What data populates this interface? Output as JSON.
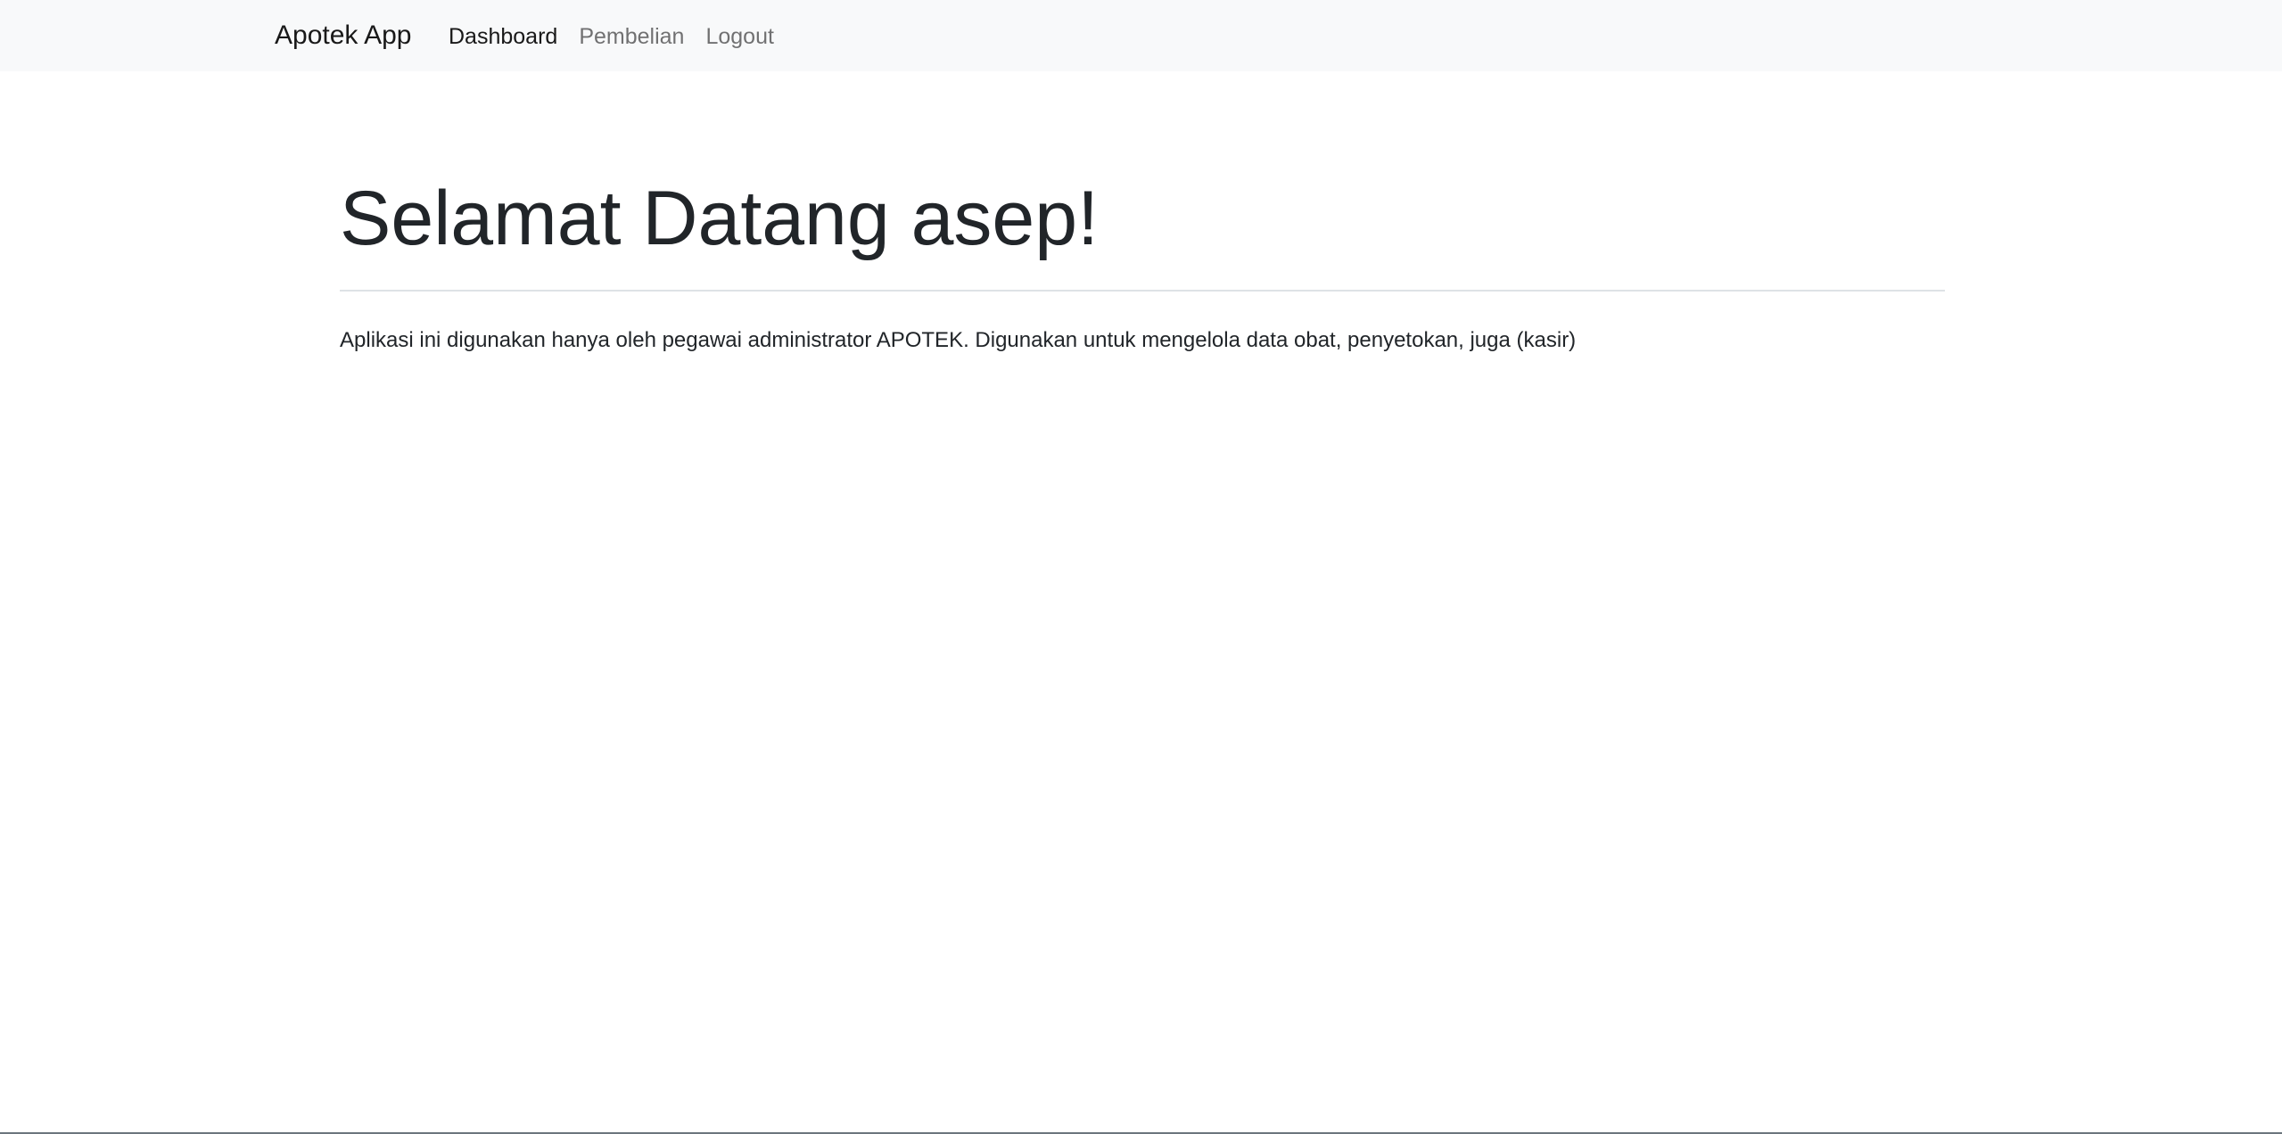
{
  "navbar": {
    "brand": "Apotek App",
    "items": [
      {
        "label": "Dashboard",
        "active": true
      },
      {
        "label": "Pembelian",
        "active": false
      },
      {
        "label": "Logout",
        "active": false
      }
    ]
  },
  "main": {
    "heading": "Selamat Datang asep!",
    "description": "Aplikasi ini digunakan hanya oleh pegawai administrator APOTEK. Digunakan untuk mengelola data obat, penyetokan, juga (kasir)"
  },
  "colors": {
    "navbar_bg": "#f8f9fa",
    "text": "#212529",
    "divider": "#dee2e6"
  }
}
